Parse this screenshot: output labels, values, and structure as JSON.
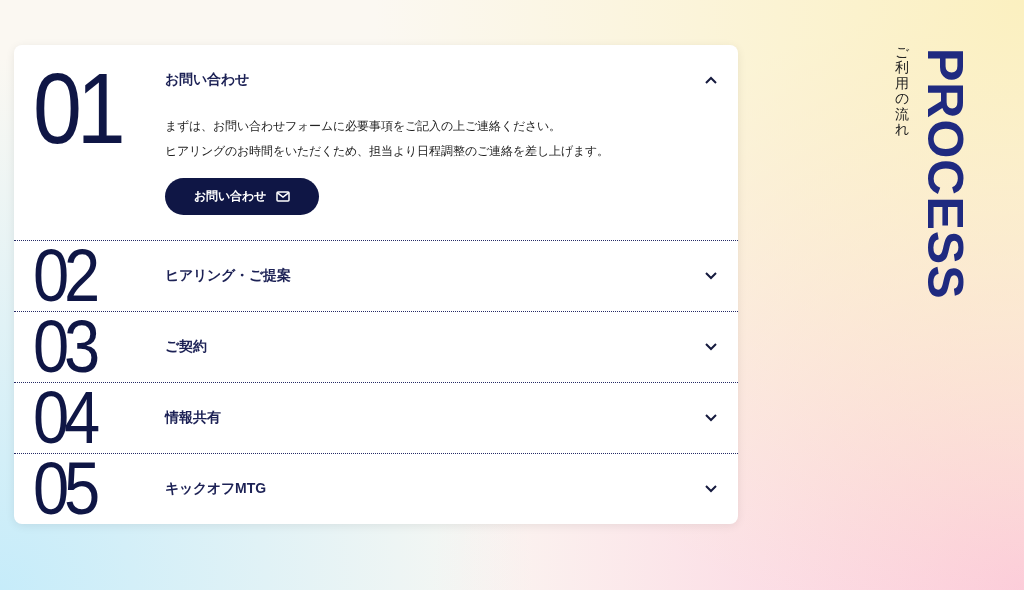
{
  "steps": [
    {
      "number": "01",
      "title": "お問い合わせ",
      "expanded": true,
      "body": [
        "まずは、お問い合わせフォームに必要事項をご記入の上ご連絡ください。",
        "ヒアリングのお時間をいただくため、担当より日程調整のご連絡を差し上げます。"
      ],
      "button": {
        "label": "お問い合わせ"
      }
    },
    {
      "number": "02",
      "title": "ヒアリング・ご提案",
      "expanded": false
    },
    {
      "number": "03",
      "title": "ご契約",
      "expanded": false
    },
    {
      "number": "04",
      "title": "情報共有",
      "expanded": false
    },
    {
      "number": "05",
      "title": "キックオフMTG",
      "expanded": false
    }
  ],
  "heading": {
    "title": "PROCESS",
    "subtitle": "ご利用の流れ"
  }
}
